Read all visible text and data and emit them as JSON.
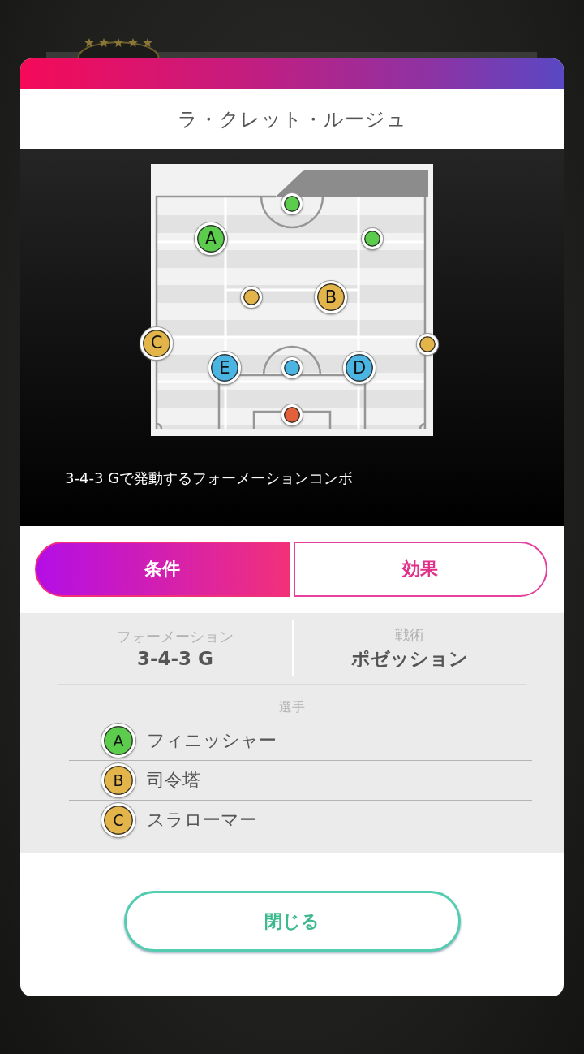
{
  "header": {
    "title": "ラ・クレット・ルージュ"
  },
  "pitch": {
    "markers": [
      {
        "color": "#5ccc4c"
      },
      {
        "label": "A",
        "color": "#5ccc4c"
      },
      {
        "color": "#5ccc4c"
      },
      {
        "color": "#e2b44a"
      },
      {
        "label": "B",
        "color": "#e2b44a"
      },
      {
        "label": "C",
        "color": "#e2b44a"
      },
      {
        "color": "#e2b44a"
      },
      {
        "label": "E",
        "color": "#4ab4e2"
      },
      {
        "color": "#4ab4e2"
      },
      {
        "label": "D",
        "color": "#4ab4e2"
      },
      {
        "color": "#e2603a"
      }
    ]
  },
  "description": "3-4-3 Gで発動するフォーメーションコンボ",
  "tabs": [
    {
      "label": "条件",
      "selected": true
    },
    {
      "label": "効果",
      "selected": false
    }
  ],
  "conditions": {
    "fields": [
      {
        "label": "フォーメーション",
        "value": "3-4-3 G"
      },
      {
        "label": "戦術",
        "value": "ポゼッション"
      }
    ],
    "players_heading": "選手",
    "players": [
      {
        "label": "A",
        "color": "#5ccc4c",
        "role": "フィニッシャー"
      },
      {
        "label": "B",
        "color": "#e2b44a",
        "role": "司令塔"
      },
      {
        "label": "C",
        "color": "#e2b44a",
        "role": "スラローマー"
      }
    ]
  },
  "close_button": {
    "label": "閉じる"
  }
}
